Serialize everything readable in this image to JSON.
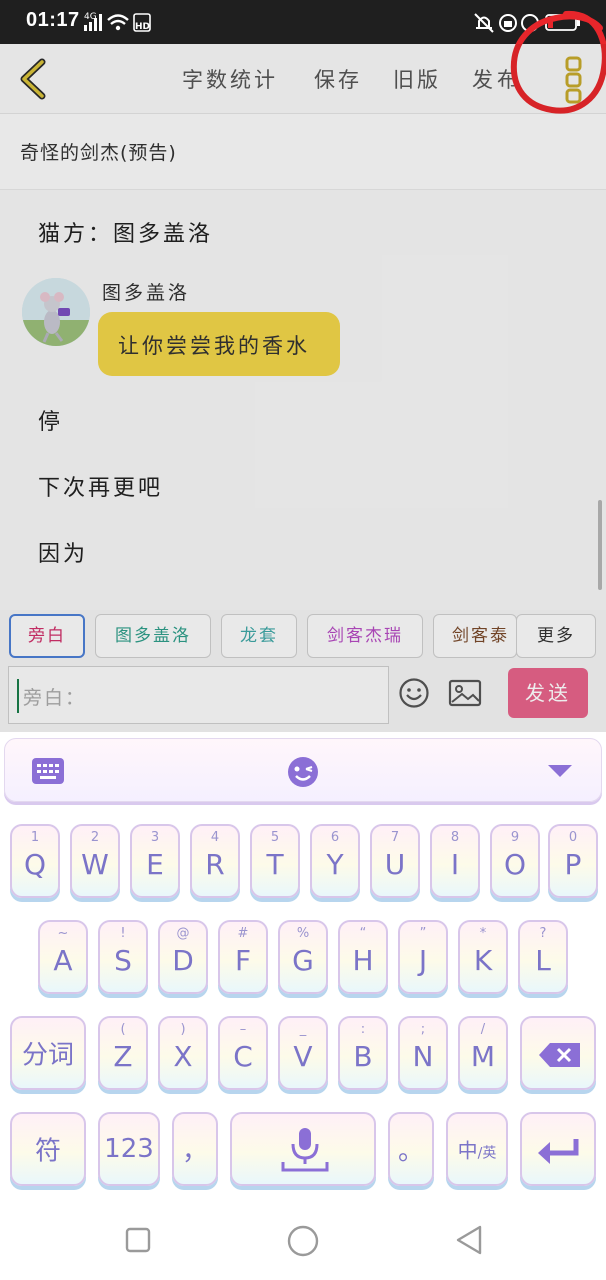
{
  "status_bar": {
    "time": "01:17",
    "network": "4G",
    "hd": "HD"
  },
  "toolbar": {
    "items": [
      "字数统计",
      "保存",
      "旧版",
      "发布"
    ]
  },
  "doc": {
    "title": "奇怪的剑杰(预告)"
  },
  "content": {
    "speaker_line": "猫方：图多盖洛",
    "bubble_name": "图多盖洛",
    "bubble_text": "让你尝尝我的香水",
    "lines": [
      "停",
      "下次再更吧",
      "因为"
    ]
  },
  "roles": {
    "chips": [
      "旁白",
      "图多盖洛",
      "龙套",
      "剑客杰瑞",
      "剑客泰"
    ],
    "chip_colors": [
      "#d0306a",
      "#2f9e8a",
      "#3fa7a6",
      "#b54bc2",
      "#7a4a2a"
    ],
    "more_label": "更多"
  },
  "input": {
    "placeholder": "旁白：",
    "send_label": "发送"
  },
  "keyboard": {
    "row1": [
      {
        "main": "Q",
        "hint": "1"
      },
      {
        "main": "W",
        "hint": "2"
      },
      {
        "main": "E",
        "hint": "3"
      },
      {
        "main": "R",
        "hint": "4"
      },
      {
        "main": "T",
        "hint": "5"
      },
      {
        "main": "Y",
        "hint": "6"
      },
      {
        "main": "U",
        "hint": "7"
      },
      {
        "main": "I",
        "hint": "8"
      },
      {
        "main": "O",
        "hint": "9"
      },
      {
        "main": "P",
        "hint": "0"
      }
    ],
    "row2": [
      {
        "main": "A",
        "hint": "~"
      },
      {
        "main": "S",
        "hint": "!"
      },
      {
        "main": "D",
        "hint": "@"
      },
      {
        "main": "F",
        "hint": "#"
      },
      {
        "main": "G",
        "hint": "%"
      },
      {
        "main": "H",
        "hint": "“"
      },
      {
        "main": "J",
        "hint": "”"
      },
      {
        "main": "K",
        "hint": "*"
      },
      {
        "main": "L",
        "hint": "?"
      }
    ],
    "row3": [
      {
        "main": "Z",
        "hint": "("
      },
      {
        "main": "X",
        "hint": ")"
      },
      {
        "main": "C",
        "hint": "–"
      },
      {
        "main": "V",
        "hint": "_"
      },
      {
        "main": "B",
        "hint": ":"
      },
      {
        "main": "N",
        "hint": ";"
      },
      {
        "main": "M",
        "hint": "/"
      }
    ],
    "fenci_label": "分词",
    "symbol_label": "符",
    "num_label": "123",
    "comma_label": "，",
    "period_label": "。",
    "lang_cn": "中",
    "lang_en": "/英"
  },
  "colors": {
    "accent_yellow": "#f1d54a",
    "send_pink": "#e7638a",
    "keyboard_text": "#7b74c8",
    "annotation_red": "#e8262b"
  },
  "icons": {
    "back": "chevron-left-icon",
    "more": "vertical-more-icon",
    "emoji": "smiley-icon",
    "image": "image-icon",
    "kb_menu": "keyboard-icon",
    "kb_emoji": "wink-emoji-icon",
    "kb_hide": "triangle-down-icon",
    "delete": "backspace-icon",
    "voice": "microphone-icon",
    "enter": "enter-icon"
  }
}
